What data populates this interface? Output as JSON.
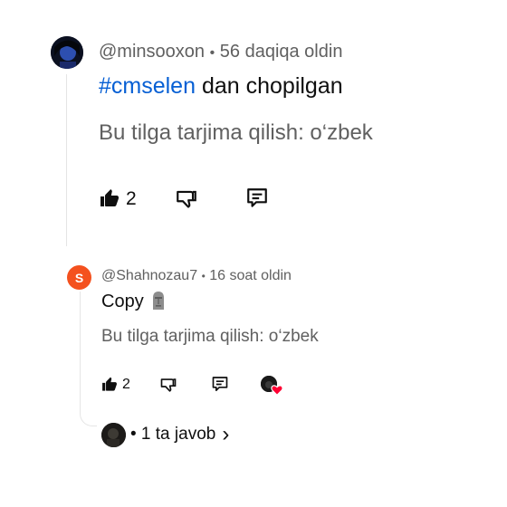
{
  "comment": {
    "author": "@minsooxon",
    "separator": "•",
    "time": "56 daqiqa oldin",
    "hashtag": "#cmselen",
    "body_rest": " dan chopilgan",
    "translate": "Bu tilga tarjima qilish: o‘zbek",
    "like_count": "2"
  },
  "reply": {
    "avatar_letter": "S",
    "avatar_color": "#f4511e",
    "author": "@Shahnozau7",
    "separator": "•",
    "time": "16 soat oldin",
    "body": "Copy",
    "translate": "Bu tilga tarjima qilish: o‘zbek",
    "like_count": "2",
    "replies_label": "• 1 ta javob",
    "chevron": "›"
  },
  "icons": {
    "like": "thumbs-up-icon",
    "dislike": "thumbs-down-icon",
    "reply": "comment-icon",
    "creator_heart": "creator-heart-icon"
  },
  "colors": {
    "link": "#065fd4",
    "meta": "#606060",
    "heart": "#ff0033"
  }
}
